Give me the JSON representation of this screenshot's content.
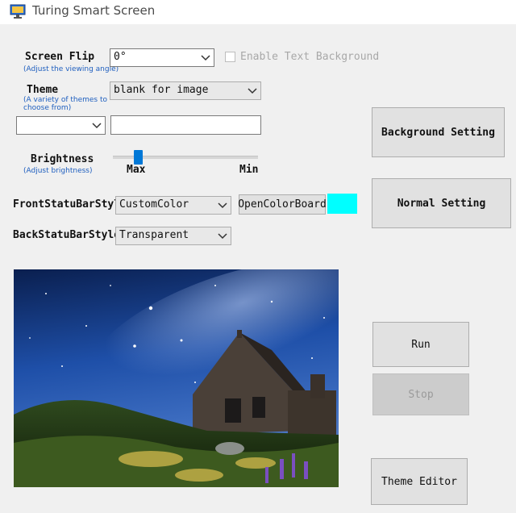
{
  "window": {
    "title": "Turing Smart Screen",
    "icon": "monitor-icon"
  },
  "screen_flip": {
    "label": "Screen Flip",
    "hint": "(Adjust the viewing angle)",
    "value": "0°"
  },
  "text_background": {
    "label": "Enable Text Background",
    "checked": false,
    "enabled": false
  },
  "theme": {
    "label": "Theme",
    "hint_line1": "(A variety of themes to",
    "hint_line2": "choose from)",
    "value": "blank for image",
    "sub_select_value": "",
    "text_value": ""
  },
  "brightness": {
    "label": "Brightness",
    "hint": "(Adjust brightness)",
    "max_label": "Max",
    "min_label": "Min",
    "level_fraction": 0.18
  },
  "front_status_bar": {
    "label": "FrontStatuBarStyle",
    "value": "CustomColor",
    "color_button": "OpenColorBoard",
    "color": "#00ffff"
  },
  "back_status_bar": {
    "label": "BackStatuBarStyle",
    "value": "Transparent"
  },
  "buttons": {
    "background_setting": "Background Setting",
    "normal_setting": "Normal Setting",
    "run": "Run",
    "stop": "Stop",
    "theme_editor": "Theme Editor"
  },
  "colors": {
    "accent": "#0078d7",
    "hint_text": "#1f5fbf"
  }
}
